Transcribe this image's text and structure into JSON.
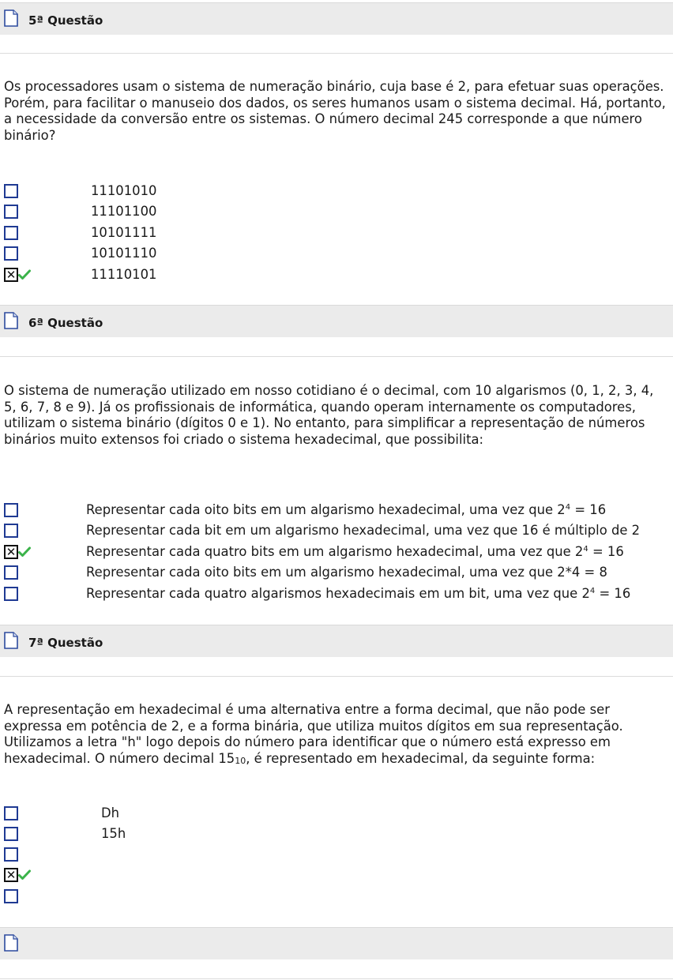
{
  "questions": [
    {
      "title": "5ª Questão",
      "text": "Os processadores usam o sistema de numeração binário, cuja base é 2, para efetuar suas operações. Porém, para facilitar o manuseio dos dados, os seres humanos usam o sistema decimal. Há, portanto, a necessidade da conversão entre os sistemas. O número decimal 245 corresponde a que número binário?",
      "options": [
        "11101010",
        "11101100",
        "10101111",
        "10101110",
        "11110101"
      ],
      "checked": 4
    },
    {
      "title": "6ª Questão",
      "text": "O sistema de numeração utilizado em nosso cotidiano é o decimal, com 10 algarismos (0, 1, 2, 3, 4, 5, 6, 7, 8 e 9). Já os profissionais de informática, quando operam internamente os computadores, utilizam o sistema binário (dígitos 0 e 1). No entanto, para simplificar a representação de números binários muito extensos foi criado o sistema hexadecimal, que possibilita:",
      "options": [
        {
          "pre": "Representar cada oito bits em um algarismo hexadecimal, uma vez que 2",
          "sup": "4",
          "post": " = 16"
        },
        {
          "pre": "Representar cada bit em um algarismo hexadecimal, uma vez que 16 é múltiplo de 2",
          "sup": "",
          "post": ""
        },
        {
          "pre": "Representar cada quatro bits em um algarismo hexadecimal, uma vez que 2",
          "sup": "4",
          "post": " = 16"
        },
        {
          "pre": "Representar cada oito bits em um algarismo hexadecimal, uma vez que 2*4 = 8",
          "sup": "",
          "post": ""
        },
        {
          "pre": "Representar cada quatro algarismos hexadecimais em um bit, uma vez que 2",
          "sup": "4",
          "post": " = 16"
        }
      ],
      "checked": 2
    },
    {
      "title": "7ª Questão",
      "text_pre": "A representação em hexadecimal é uma alternativa entre a forma decimal, que não pode ser expressa em potência de 2, e a forma binária, que utiliza muitos dígitos em sua representação. Utilizamos a letra \"h\" logo depois do número para identificar que o número está expresso em hexadecimal. O número decimal 15",
      "text_sub": "10",
      "text_post": ", é representado em hexadecimal, da seguinte forma:",
      "options": [
        "Dh",
        "15h",
        "",
        "",
        ""
      ],
      "checked": 3
    }
  ],
  "checkmark_color": "#3bb34a",
  "checkbox_color": "#1f3a93",
  "header_bg": "#ebebeb"
}
